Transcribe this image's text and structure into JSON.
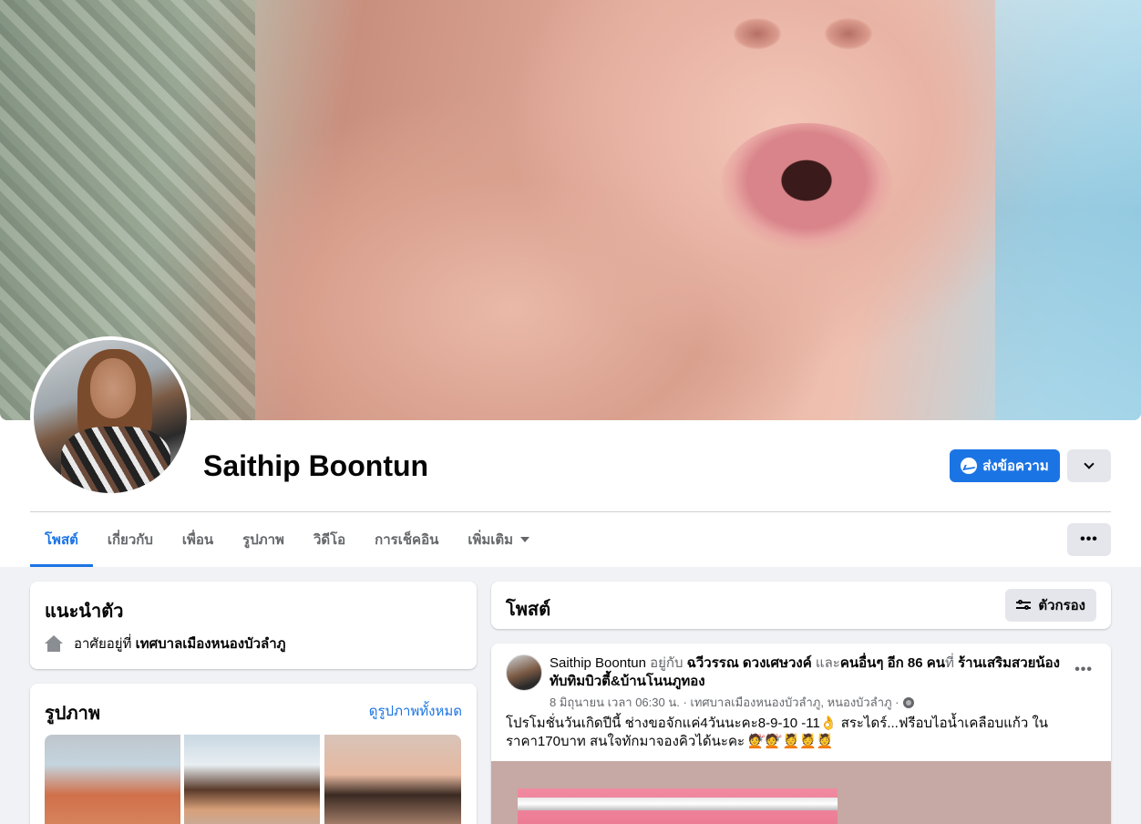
{
  "profile": {
    "name": "Saithip Boontun",
    "message_button": "ส่งข้อความ"
  },
  "tabs": [
    {
      "label": "โพสต์",
      "active": true
    },
    {
      "label": "เกี่ยวกับ"
    },
    {
      "label": "เพื่อน"
    },
    {
      "label": "รูปภาพ"
    },
    {
      "label": "วิดีโอ"
    },
    {
      "label": "การเช็คอิน"
    },
    {
      "label": "เพิ่มเติม"
    }
  ],
  "intro": {
    "title": "แนะนำตัว",
    "lives_prefix": "อาศัยอยู่ที่",
    "lives_place": "เทศบาลเมืองหนองบัวลำภู"
  },
  "photos": {
    "title": "รูปภาพ",
    "see_all": "ดูรูปภาพทั้งหมด"
  },
  "posts": {
    "title": "โพสต์",
    "filter_label": "ตัวกรอง"
  },
  "post": {
    "author": "Saithip Boontun",
    "with_word": "อยู่กับ",
    "tagged": "ฉวีวรรณ ดวงเศษวงค์",
    "and_word": "และ",
    "others": "คนอื่นๆ อีก 86 คน",
    "at_word": "ที่",
    "place": "ร้านเสริมสวยน้องทับทิมบิวตี้&บ้านโนนภูทอง",
    "meta": "8 มิถุนายน เวลา 06:30 น. · เทศบาลเมืองหนองบัวลำภู, หนองบัวลำภู ·",
    "text": "โปรโมชั่นวันเกิดปีนี้ ช่างขอจักแค่4วันนะคะ8-9-10 -11👌 สระไดร์...ฟรีอบไอน้ำเคลือบแก้ว ในราคา170บาท สนใจทักมาจองคิวได้นะคะ 💇💇💆💆💆"
  },
  "colors": {
    "accent": "#1b74e4",
    "background": "#f0f2f5",
    "secondary_text": "#65676b"
  }
}
